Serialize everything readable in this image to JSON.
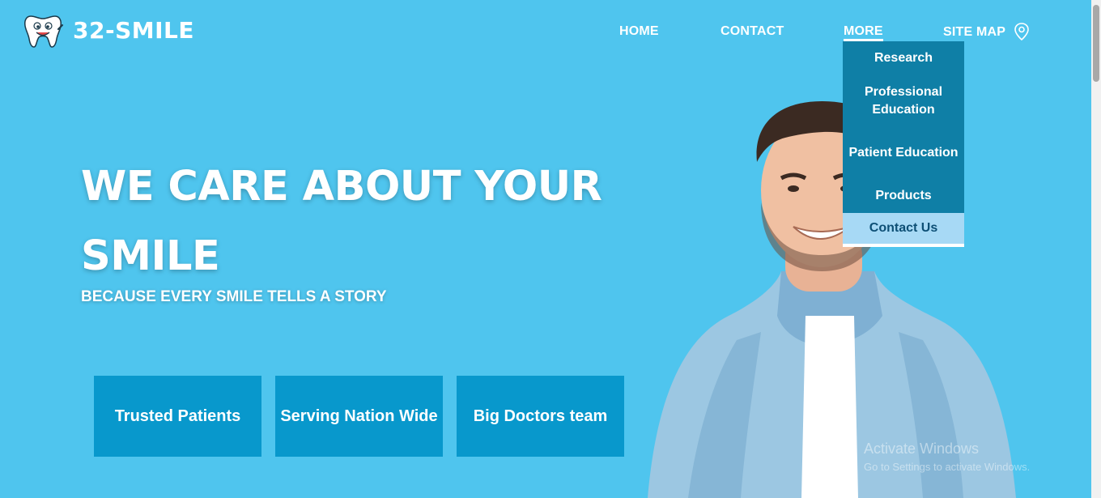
{
  "brand": {
    "name": "32-SMILE",
    "logo_icon": "tooth-mascot-icon"
  },
  "nav": {
    "items": [
      {
        "label": "HOME"
      },
      {
        "label": "CONTACT"
      },
      {
        "label": "MORE"
      },
      {
        "label": "SITE MAP",
        "icon": "location-pin-icon"
      }
    ],
    "active": "MORE"
  },
  "dropdown": {
    "items": [
      {
        "label": "Research"
      },
      {
        "label": "Professional Education"
      },
      {
        "label": "Patient Education"
      },
      {
        "label": "Products"
      },
      {
        "label": "Contact Us"
      }
    ],
    "highlighted": "Contact Us"
  },
  "hero": {
    "title": "WE CARE ABOUT YOUR SMILE",
    "subtitle": "BECAUSE EVERY SMILE TELLS A STORY"
  },
  "features": [
    {
      "label": "Trusted Patients"
    },
    {
      "label": "Serving Nation Wide"
    },
    {
      "label": "Big Doctors team"
    }
  ],
  "watermark": {
    "line1": "Activate Windows",
    "line2": "Go to Settings to activate Windows."
  },
  "colors": {
    "background": "#4fc5ee",
    "card": "#0898cc",
    "dropdown": "#0f7fa6",
    "dropdown_active": "#a7d9f5"
  }
}
